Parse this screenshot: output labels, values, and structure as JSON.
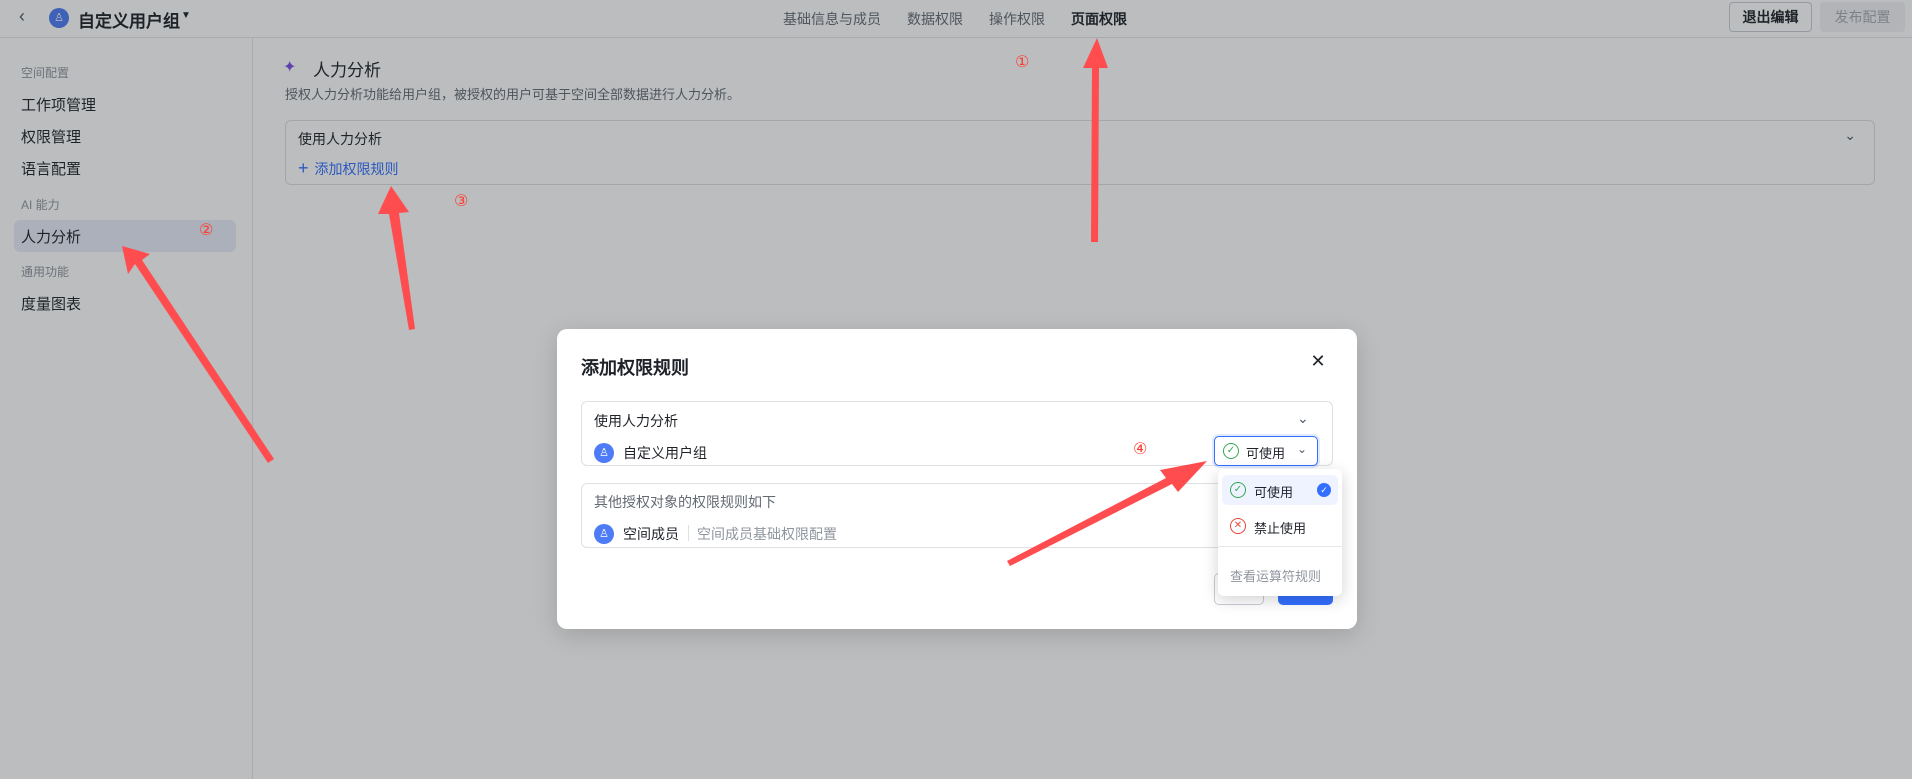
{
  "header": {
    "group_name": "自定义用户组",
    "tabs": [
      "基础信息与成员",
      "数据权限",
      "操作权限",
      "页面权限"
    ],
    "active_tab": "页面权限",
    "exit_label": "退出编辑",
    "publish_label": "发布配置"
  },
  "sidebar": {
    "sections": [
      {
        "title": "空间配置",
        "items": [
          "工作项管理",
          "权限管理",
          "语言配置"
        ]
      },
      {
        "title": "AI 能力",
        "items": [
          "人力分析"
        ]
      },
      {
        "title": "通用功能",
        "items": [
          "度量图表"
        ]
      }
    ],
    "active_item": "人力分析"
  },
  "main": {
    "title": "人力分析",
    "description": "授权人力分析功能给用户组，被授权的用户可基于空间全部数据进行人力分析。",
    "rule_box_title": "使用人力分析",
    "add_rule_label": "添加权限规则"
  },
  "dialog": {
    "title": "添加权限规则",
    "box1_title": "使用人力分析",
    "box1_member": "自定义用户组",
    "select_value": "可使用",
    "box2_title": "其他授权对象的权限规则如下",
    "box2_member": "空间成员",
    "box2_desc": "空间成员基础权限配置"
  },
  "dropdown": {
    "options": [
      "可使用",
      "禁止使用"
    ],
    "selected": "可使用",
    "footer": "查看运算符规则"
  },
  "annotations": [
    "①",
    "②",
    "③",
    "④"
  ],
  "colors": {
    "accent": "#3370ff",
    "annotation": "#ff3b30",
    "sidebar_active": "#e8edf9"
  }
}
